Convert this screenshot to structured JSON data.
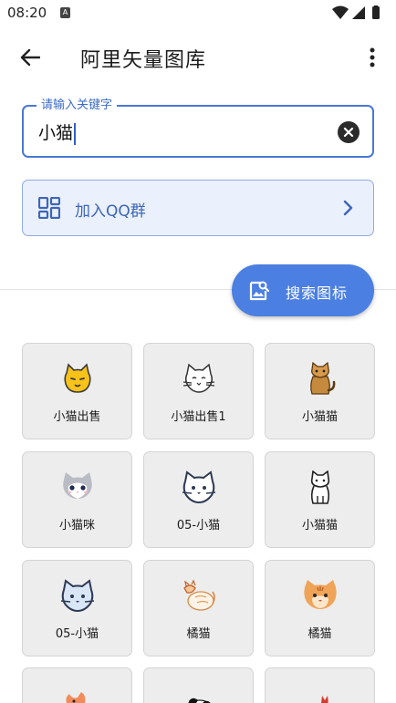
{
  "status": {
    "time": "08:20",
    "notification_badge": "A"
  },
  "app_bar": {
    "title": "阿里矢量图库"
  },
  "search": {
    "legend": "请输入关键字",
    "value": "小猫"
  },
  "qq_group": {
    "label": "加入QQ群"
  },
  "fab": {
    "label": "搜索图标"
  },
  "accent_color": "#4b7fe2",
  "icons": [
    {
      "label": "小猫出售",
      "icon": "yellow-cat-face-icon"
    },
    {
      "label": "小猫出售1",
      "icon": "outline-cat-face-icon"
    },
    {
      "label": "小猫猫",
      "icon": "brown-sitting-cat-icon"
    },
    {
      "label": "小猫咪",
      "icon": "grey-white-cat-face-icon"
    },
    {
      "label": "05-小猫",
      "icon": "line-cat-face-icon"
    },
    {
      "label": "小猫猫",
      "icon": "sitting-cat-line-icon"
    },
    {
      "label": "05-小猫",
      "icon": "blue-cat-face-icon"
    },
    {
      "label": "橘猫",
      "icon": "sketch-orange-cat-icon"
    },
    {
      "label": "橘猫",
      "icon": "orange-tabby-cat-face-icon"
    },
    {
      "label": "",
      "icon": "orange-cat-icon"
    },
    {
      "label": "",
      "icon": "black-white-cat-icon"
    },
    {
      "label": "",
      "icon": "red-cat-icon"
    }
  ]
}
